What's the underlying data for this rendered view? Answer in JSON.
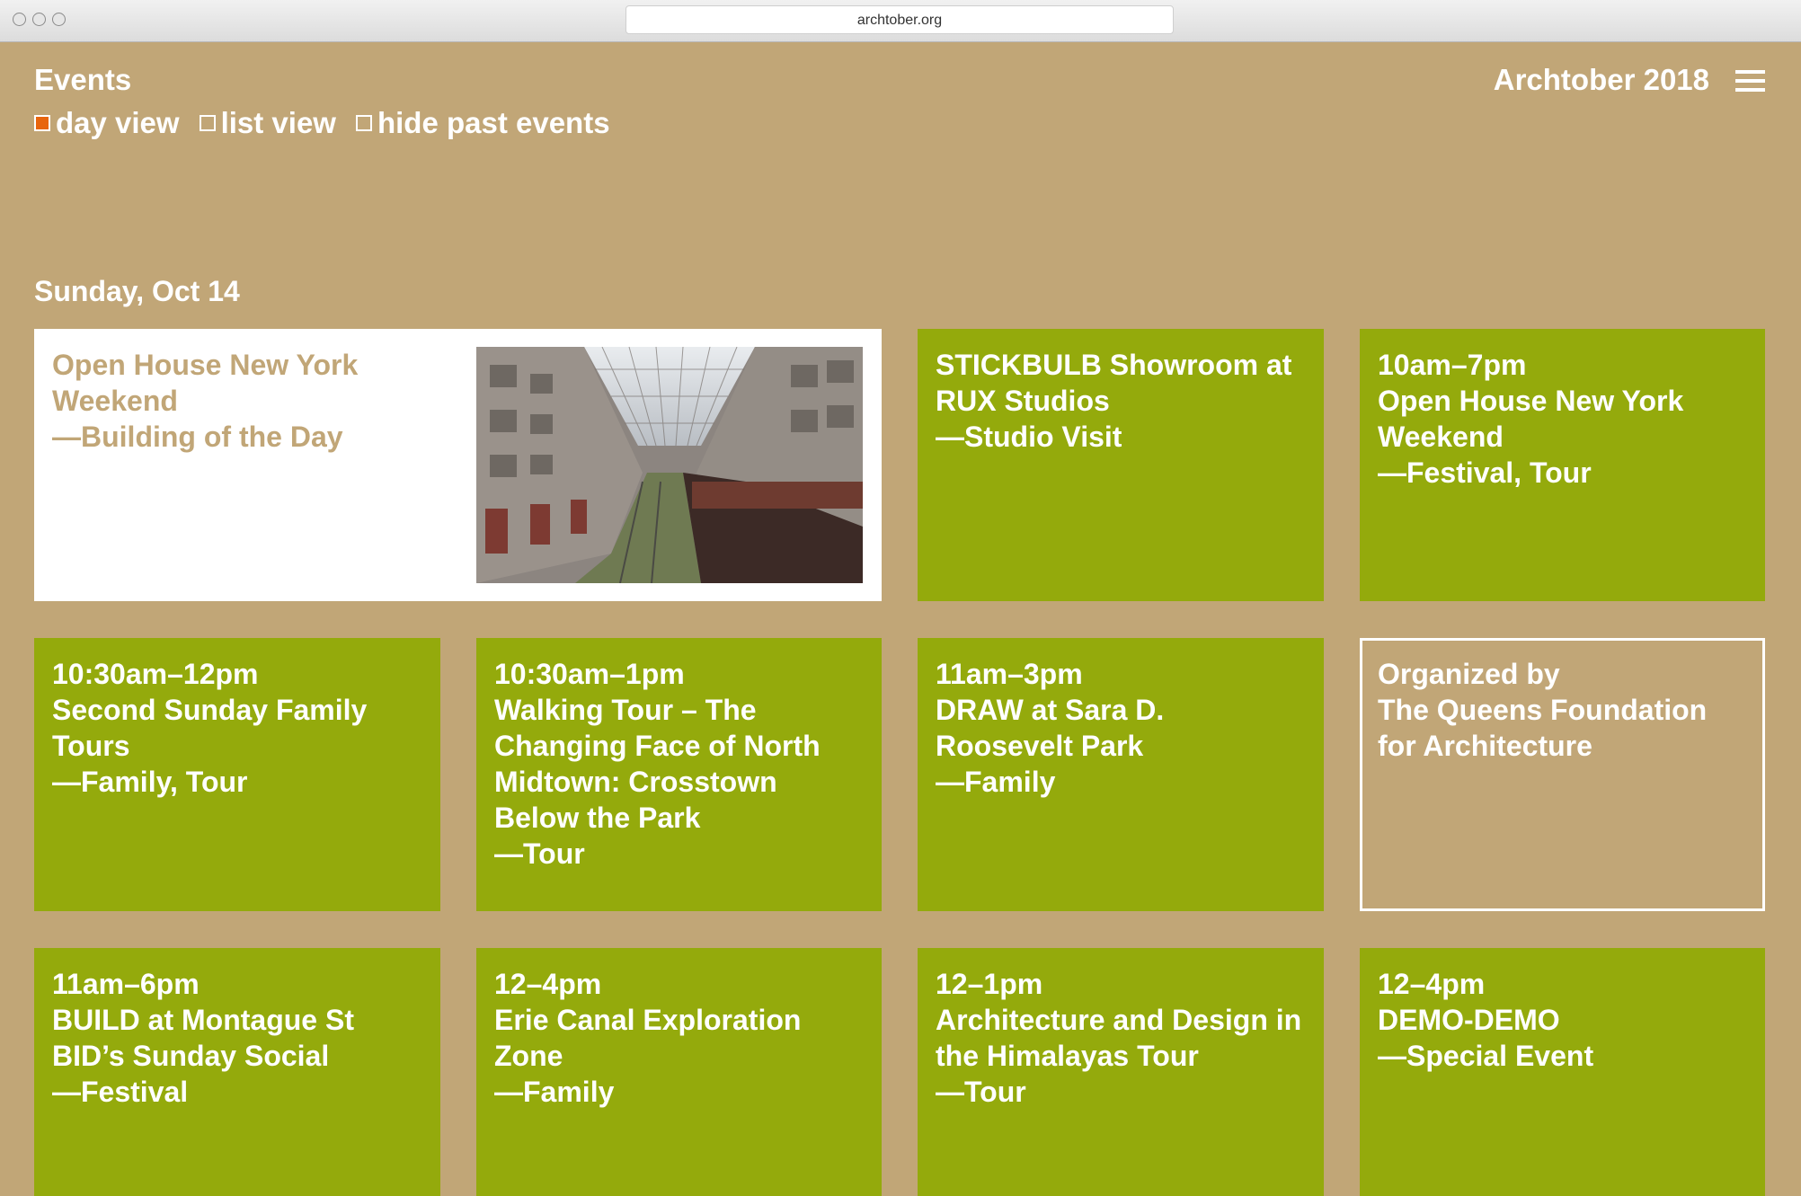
{
  "browser": {
    "url": "archtober.org"
  },
  "header": {
    "title": "Events",
    "brand": "Archtober 2018"
  },
  "filters": [
    {
      "label": "day view",
      "checked": true
    },
    {
      "label": "list view",
      "checked": false
    },
    {
      "label": "hide past events",
      "checked": false
    }
  ],
  "day_heading": "Sunday, Oct 14",
  "featured": {
    "title_line1": "Open House New York",
    "title_line2": "Weekend",
    "category": "—Building of the Day"
  },
  "events": [
    {
      "time": "",
      "title": [
        "STICKBULB Showroom at",
        "RUX Studios"
      ],
      "category": "—Studio Visit"
    },
    {
      "time": "10am–7pm",
      "title": [
        "Open House New York",
        "Weekend"
      ],
      "category": "—Festival, Tour"
    },
    {
      "time": "10:30am–12pm",
      "title": [
        "Second Sunday Family",
        "Tours"
      ],
      "category": "—Family, Tour"
    },
    {
      "time": "10:30am–1pm",
      "title": [
        "Walking Tour – The",
        "Changing Face of North",
        "Midtown: Crosstown",
        "Below the Park"
      ],
      "category": "—Tour"
    },
    {
      "time": "11am–3pm",
      "title": [
        "DRAW at Sara D.",
        "Roosevelt Park"
      ],
      "category": "—Family"
    },
    {
      "time": "11am–6pm",
      "title": [
        "BUILD at Montague St",
        "BID’s Sunday Social"
      ],
      "category": "—Festival"
    },
    {
      "time": "12–4pm",
      "title": [
        "Erie Canal Exploration",
        "Zone"
      ],
      "category": "—Family"
    },
    {
      "time": "12–1pm",
      "title": [
        "Architecture and Design in",
        "the Himalayas Tour"
      ],
      "category": "—Tour"
    },
    {
      "time": "12–4pm",
      "title": [
        "DEMO-DEMO"
      ],
      "category": "—Special Event"
    }
  ],
  "organizer": {
    "line1": "Organized by",
    "line2": "The Queens Foundation",
    "line3": "for Architecture"
  },
  "colors": {
    "background": "#c1a677",
    "card_green": "#94aa0c",
    "checkbox_active": "#e8650e"
  }
}
